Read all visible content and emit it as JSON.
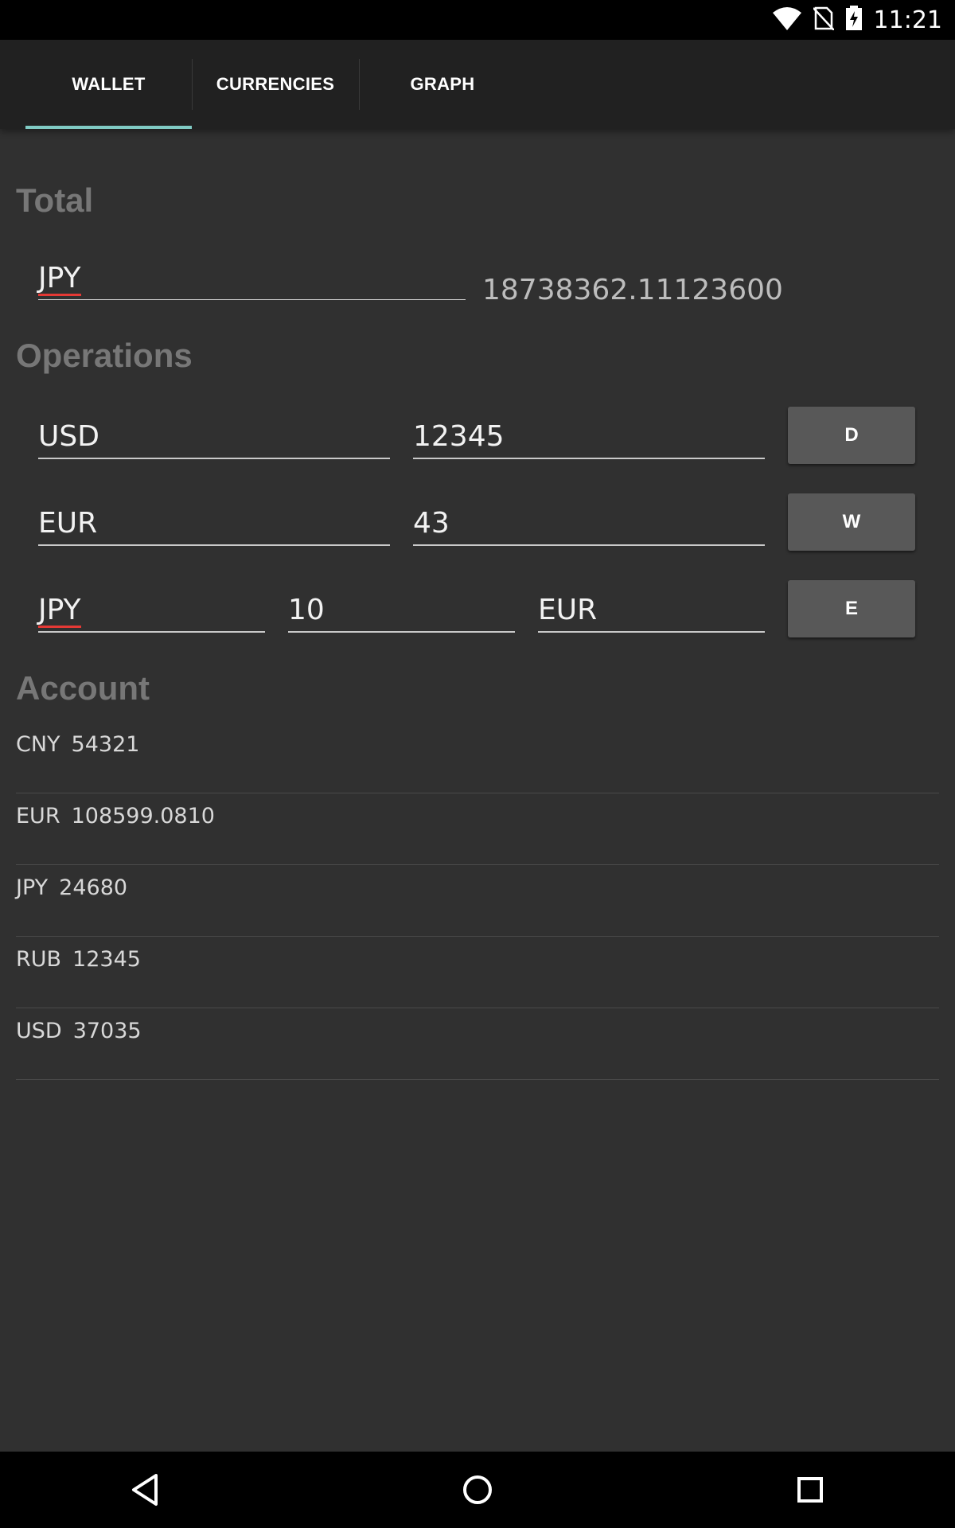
{
  "status_bar": {
    "time": "11:21",
    "icons": [
      "wifi-icon",
      "no-sim-icon",
      "battery-charging-icon"
    ]
  },
  "tabs": [
    {
      "label": "WALLET",
      "selected": true
    },
    {
      "label": "CURRENCIES",
      "selected": false
    },
    {
      "label": "GRAPH",
      "selected": false
    }
  ],
  "total": {
    "title": "Total",
    "currency": "JPY",
    "value": "18738362.11123600"
  },
  "operations": {
    "title": "Operations",
    "deposit": {
      "currency": "USD",
      "amount": "12345",
      "button_label": "D"
    },
    "withdraw": {
      "currency": "EUR",
      "amount": "43",
      "button_label": "W"
    },
    "exchange": {
      "from_currency": "JPY",
      "amount": "10",
      "to_currency": "EUR",
      "button_label": "E"
    }
  },
  "account": {
    "title": "Account",
    "rows": [
      {
        "code": "CNY",
        "value": "54321"
      },
      {
        "code": "EUR",
        "value": "108599.0810"
      },
      {
        "code": "JPY",
        "value": "24680"
      },
      {
        "code": "RUB",
        "value": "12345"
      },
      {
        "code": "USD",
        "value": "37035"
      }
    ]
  },
  "nav_bar": {
    "icons": [
      "back-icon",
      "home-icon",
      "recents-icon"
    ]
  },
  "colors": {
    "background": "#303030",
    "tab_bar": "#212121",
    "tab_indicator": "#80cbc4",
    "section_title": "#777777",
    "button": "#585858",
    "spellcheck_underline": "#e53935"
  }
}
